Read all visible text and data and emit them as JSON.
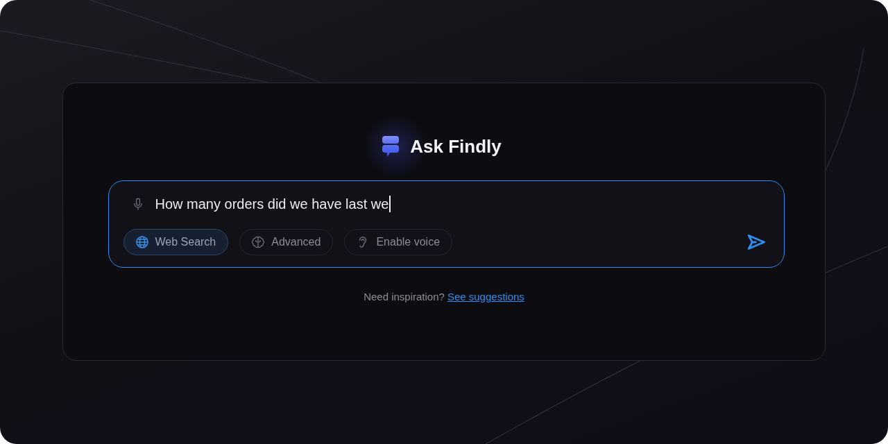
{
  "app": {
    "title": "Ask Findly"
  },
  "query": {
    "value": "How many orders did we have last we",
    "focused": true
  },
  "options": [
    {
      "label": "Web Search",
      "kind": "globe",
      "selected": true
    },
    {
      "label": "Advanced",
      "kind": "brain",
      "selected": false
    },
    {
      "label": "Enable voice",
      "kind": "ear",
      "selected": false
    }
  ],
  "footer": {
    "prompt": "Need inspiration?",
    "link": "See suggestions"
  }
}
